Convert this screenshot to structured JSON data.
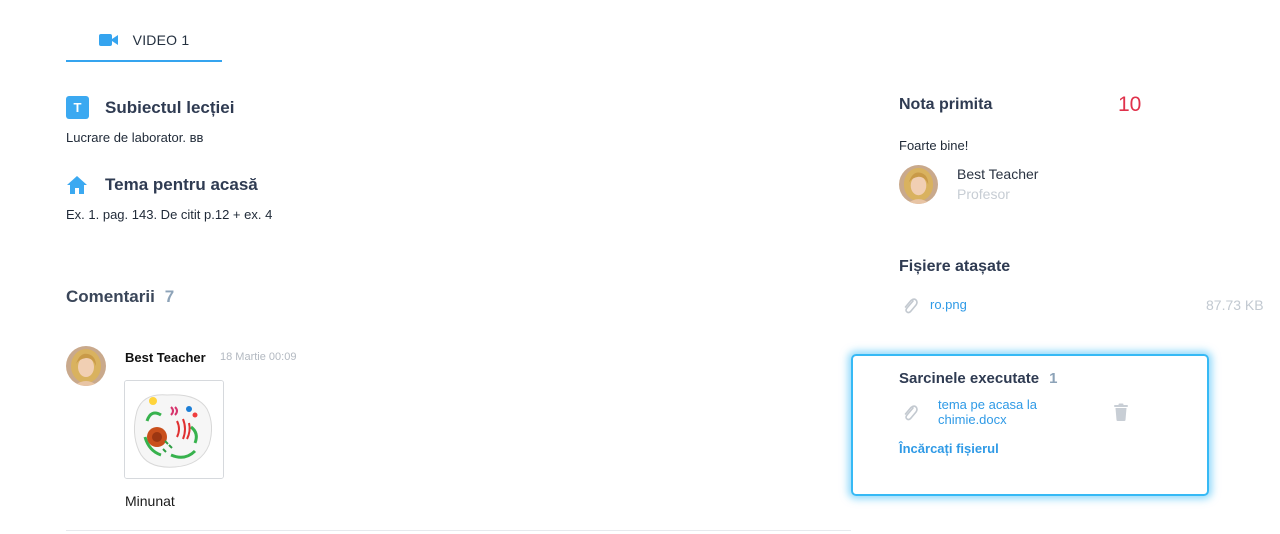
{
  "tabs": [
    {
      "label": "VIDEO 1",
      "icon": "video-camera-icon",
      "active": true
    }
  ],
  "lesson": {
    "subject_title": "Subiectul lecției",
    "subject_badge": "T",
    "subject_text": "Lucrare de laborator. вв",
    "homework_title": "Tema pentru acasă",
    "homework_icon": "home-icon",
    "homework_text": "Ex. 1. pag. 143. De citit p.12 + ex. 4"
  },
  "comments": {
    "title": "Comentarii",
    "count": "7",
    "items": [
      {
        "author": "Best Teacher",
        "date": "18 Martie 00:09",
        "attachment": "cell-diagram-image",
        "text": "Minunat"
      }
    ]
  },
  "grade": {
    "title": "Nota primita",
    "value": "10",
    "feedback": "Foarte bine!",
    "teacher_name": "Best Teacher",
    "teacher_role": "Profesor"
  },
  "attached_files": {
    "title": "Fișiere atașate",
    "items": [
      {
        "name": "ro.png",
        "size": "87.73 KB",
        "icon": "paperclip-icon"
      }
    ]
  },
  "completed_tasks": {
    "title": "Sarcinele executate",
    "count": "1",
    "items": [
      {
        "name": "tema pe acasa la chimie.docx",
        "icon": "paperclip-icon",
        "action_icon": "trash-icon"
      }
    ],
    "upload_label": "Încărcați fișierul"
  },
  "colors": {
    "accent": "#35a4ef",
    "grade": "#e0314b",
    "highlight": "#36b9f5"
  }
}
